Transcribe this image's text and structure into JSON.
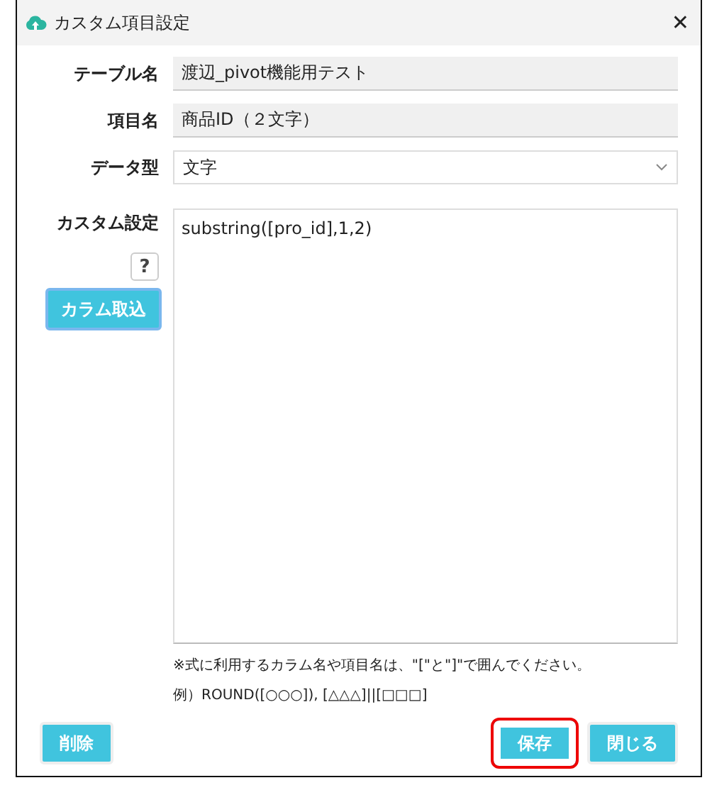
{
  "window": {
    "title": "カスタム項目設定",
    "close": "✕"
  },
  "fields": [
    {
      "label": "テーブル名",
      "kind": "readonly",
      "value": "渡辺_pivot機能用テスト"
    },
    {
      "label": "項目名",
      "kind": "readonly",
      "value": "商品ID（２文字）"
    },
    {
      "label": "データ型",
      "kind": "select",
      "value": "文字"
    }
  ],
  "custom": {
    "label": "カスタム設定",
    "help": "?",
    "import_button": "カラム取込",
    "value": "substring([pro_id],1,2)"
  },
  "notes": [
    "※式に利用するカラム名や項目名は、\"[\"と\"]\"で囲んでください。",
    "例）ROUND([○○○]), [△△△]||[□□□]"
  ],
  "left_buttons": [
    {
      "label": "削除",
      "highlighted": false
    }
  ],
  "right_buttons": [
    {
      "label": "保存",
      "highlighted": true
    },
    {
      "label": "閉じる",
      "highlighted": false
    }
  ]
}
